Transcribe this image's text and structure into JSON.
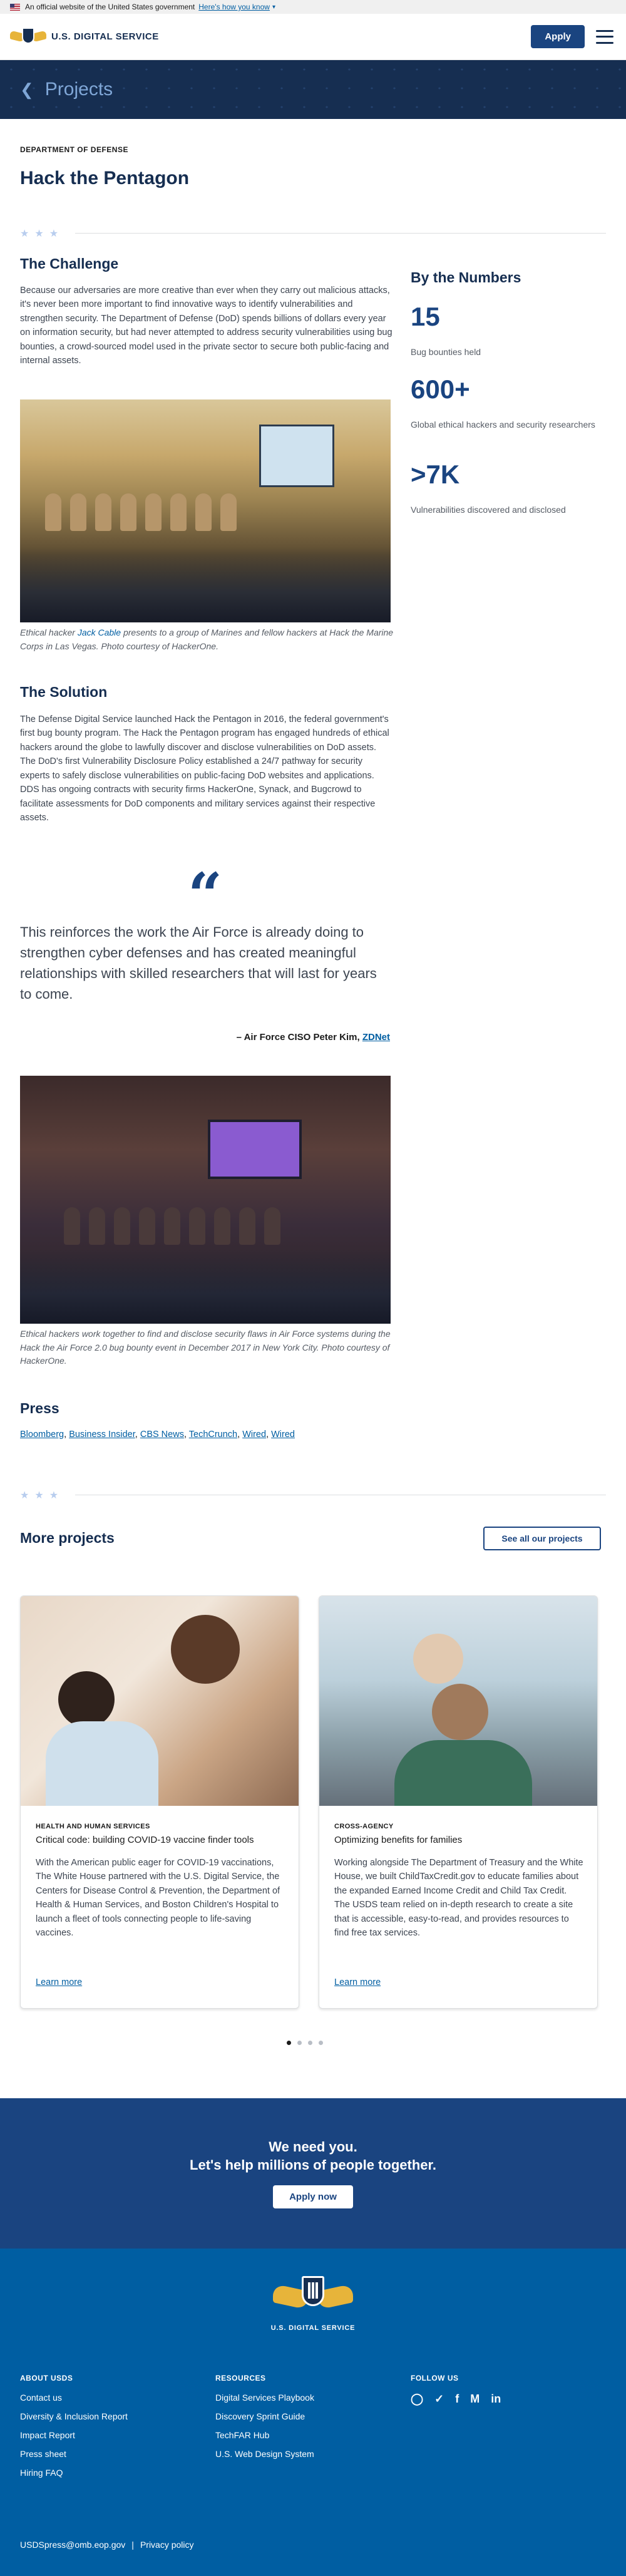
{
  "gov_banner": {
    "text": "An official website of the United States government",
    "link": "Here's how you know"
  },
  "header": {
    "brand": "U.S. DIGITAL SERVICE",
    "apply_label": "Apply"
  },
  "hero": {
    "title": "Projects"
  },
  "project": {
    "agency": "DEPARTMENT OF DEFENSE",
    "title": "Hack the Pentagon"
  },
  "challenge": {
    "heading": "The Challenge",
    "body": "Because our adversaries are more creative than ever when they carry out malicious attacks, it's never been more important to find innovative ways to identify vulnerabilities and strengthen security. The Department of Defense (DoD) spends billions of dollars every year on information security, but had never attempted to address security vulnerabilities using bug bounties, a crowd-sourced model used in the private sector to secure both public-facing and internal assets.",
    "caption_pre": "Ethical hacker ",
    "caption_link": "Jack Cable",
    "caption_post": " presents to a group of Marines and fellow hackers at Hack the Marine Corps in Las Vegas. Photo courtesy of HackerOne."
  },
  "solution": {
    "heading": "The Solution",
    "body": "The Defense Digital Service launched Hack the Pentagon in 2016, the federal government's first bug bounty program. The Hack the Pentagon program has engaged hundreds of ethical hackers around the globe to lawfully discover and disclose vulnerabilities on DoD assets. The DoD's first Vulnerability Disclosure Policy established a 24/7 pathway for security experts to safely disclose vulnerabilities on public-facing DoD websites and applications. DDS has ongoing contracts with security firms HackerOne, Synack, and Bugcrowd to facilitate assessments for DoD components and military services against their respective assets."
  },
  "quote": {
    "mark": "“",
    "text": "This reinforces the work the Air Force is already doing to strengthen cyber defenses and has created meaningful relationships with skilled researchers that will last for years to come.",
    "attribution": "– Air Force CISO Peter Kim, ",
    "source": "ZDNet"
  },
  "photo2": {
    "caption": "Ethical hackers work together to find and disclose security flaws in Air Force systems during the Hack the Air Force 2.0 bug bounty event in December 2017 in New York City. Photo courtesy of HackerOne."
  },
  "press": {
    "heading": "Press",
    "links": [
      "Bloomberg",
      "Business Insider",
      "CBS News",
      "TechCrunch",
      "Wired",
      "Wired"
    ]
  },
  "by_numbers": {
    "heading": "By the Numbers",
    "stats": [
      {
        "value": "15",
        "label": "Bug bounties held"
      },
      {
        "value": "600+",
        "label": "Global ethical hackers and security researchers"
      },
      {
        "value": ">7K",
        "label": "Vulnerabilities discovered and disclosed"
      }
    ]
  },
  "more_projects": {
    "heading": "More projects",
    "see_all": "See all our projects",
    "cards": [
      {
        "tag": "HEALTH AND HUMAN SERVICES",
        "subtitle": "Critical code: building COVID-19 vaccine finder tools",
        "body": "With the American public eager for COVID-19 vaccinations, The White House partnered with the U.S. Digital Service, the Centers for Disease Control & Prevention, the Department of Health & Human Services, and Boston Children's Hospital to launch a fleet of tools connecting people to life-saving vaccines.",
        "link": "Learn more"
      },
      {
        "tag": "CROSS-AGENCY",
        "subtitle": "Optimizing benefits for families",
        "body": "Working alongside The Department of Treasury and the White House, we built ChildTaxCredit.gov to educate families about the expanded Earned Income Credit and Child Tax Credit. The USDS team relied on in-depth research to create a site that is accessible, easy-to-read, and provides resources to find free tax services.",
        "link": "Learn more"
      }
    ]
  },
  "cta": {
    "line1": "We need you.",
    "line2": "Let's help millions of people together.",
    "button": "Apply now"
  },
  "footer": {
    "brand": "U.S. DIGITAL SERVICE",
    "about": {
      "heading": "ABOUT USDS",
      "links": [
        "Contact us",
        "Diversity & Inclusion Report",
        "Impact Report",
        "Press sheet",
        "Hiring FAQ"
      ]
    },
    "resources": {
      "heading": "RESOURCES",
      "links": [
        "Digital Services Playbook",
        "Discovery Sprint Guide",
        "TechFAR Hub",
        "U.S. Web Design System"
      ]
    },
    "follow": {
      "heading": "FOLLOW US",
      "icons": [
        "instagram-icon",
        "twitter-icon",
        "facebook-icon",
        "medium-icon",
        "linkedin-icon"
      ]
    },
    "email": "USDSpress@omb.eop.gov",
    "privacy": "Privacy policy"
  },
  "colors": {
    "navy": "#162e51",
    "primary": "#1a4480",
    "footer_blue": "#005ea2",
    "gold": "#e7b43a"
  }
}
